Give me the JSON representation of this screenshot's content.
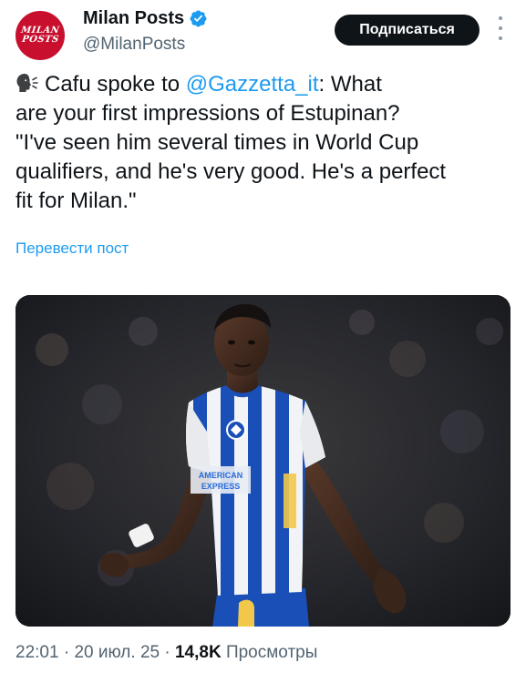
{
  "account": {
    "display_name": "Milan Posts",
    "handle": "@MilanPosts",
    "avatar_text_line1": "MILAN",
    "avatar_text_line2": "POSTS",
    "brand_color": "#c8102e",
    "verified": true
  },
  "actions": {
    "subscribe_label": "Подписаться",
    "more_icon": "more-vertical-icon"
  },
  "tweet": {
    "speaking_icon": "speaking-head-icon",
    "text_lines": [
      {
        "before": "Cafu spoke to ",
        "mention": "@Gazzetta_it",
        "after": ": What"
      },
      "are your first impressions of Estupinan?",
      "\"I've seen him several times in World Cup",
      "qualifiers, and he's very good. He's a perfect",
      "fit for Milan.\""
    ],
    "translate_label": "Перевести пост"
  },
  "media": {
    "type": "photo",
    "shirt_sponsor_line1": "AMERICAN",
    "shirt_sponsor_line2": "EXPRESS"
  },
  "meta": {
    "time": "22:01",
    "separator": "·",
    "date": "20 июл. 25",
    "views_count": "14,8K",
    "views_label": "Просмотры"
  },
  "colors": {
    "link": "#1d9bf0",
    "secondary_text": "#536471",
    "primary_text": "#0f1419",
    "button_bg": "#0f1419"
  }
}
